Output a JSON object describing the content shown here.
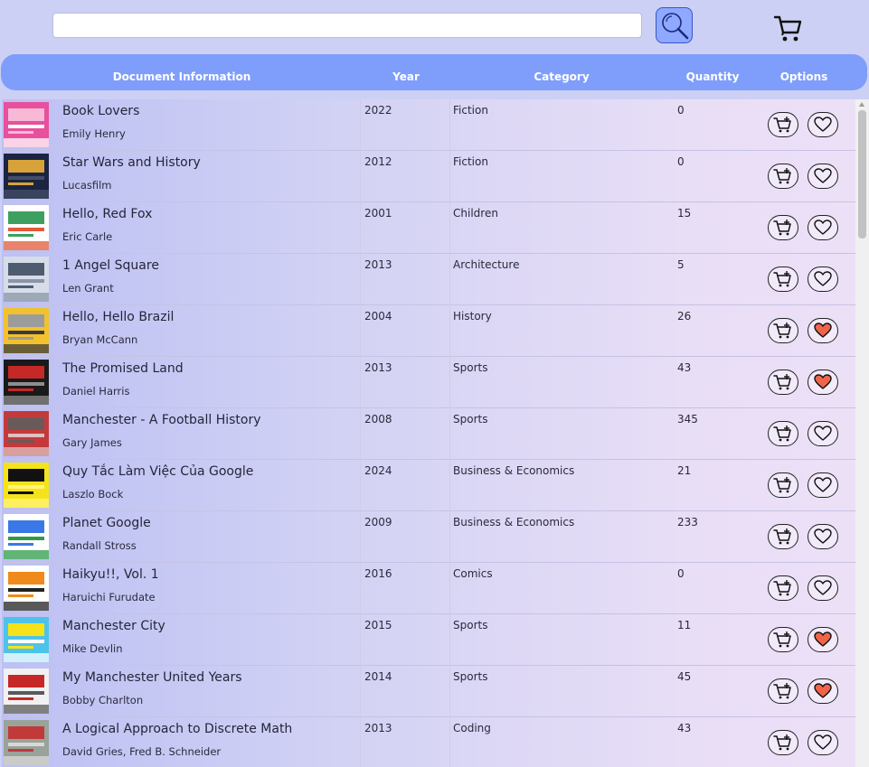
{
  "search": {
    "placeholder": "",
    "value": ""
  },
  "icons": {
    "search": "search-icon",
    "cart": "cart-icon",
    "add_to_cart": "add-to-cart-icon",
    "favorite": "heart-icon"
  },
  "colors": {
    "page_bg": "#cdd0f5",
    "header_bg": "#7f9dfb",
    "search_button_bg": "#8ea9ff",
    "favorite_active": "#f0654a"
  },
  "table": {
    "columns": [
      "Document Information",
      "Year",
      "Category",
      "Quantity",
      "Options"
    ],
    "rows": [
      {
        "title": "Book Lovers",
        "author": "Emily Henry",
        "year": "2022",
        "category": "Fiction",
        "quantity": "0",
        "favorite": false,
        "cover_colors": [
          "#e84f9c",
          "#f7b9d6",
          "#ffffff"
        ]
      },
      {
        "title": "Star Wars and History",
        "author": "Lucasfilm",
        "year": "2012",
        "category": "Fiction",
        "quantity": "0",
        "favorite": false,
        "cover_colors": [
          "#1b2440",
          "#d8a23a",
          "#444c68"
        ]
      },
      {
        "title": "Hello, Red Fox",
        "author": "Eric Carle",
        "year": "2001",
        "category": "Children",
        "quantity": "15",
        "favorite": false,
        "cover_colors": [
          "#ffffff",
          "#3da060",
          "#e35a3a"
        ]
      },
      {
        "title": "1 Angel Square",
        "author": "Len Grant",
        "year": "2013",
        "category": "Architecture",
        "quantity": "5",
        "favorite": false,
        "cover_colors": [
          "#d6dde8",
          "#4f5b6f",
          "#8a95a8"
        ]
      },
      {
        "title": "Hello, Hello Brazil",
        "author": "Bryan McCann",
        "year": "2004",
        "category": "History",
        "quantity": "26",
        "favorite": true,
        "cover_colors": [
          "#f2c12e",
          "#9c9c9c",
          "#3c3c3c"
        ]
      },
      {
        "title": "The Promised Land",
        "author": "Daniel Harris",
        "year": "2013",
        "category": "Sports",
        "quantity": "43",
        "favorite": true,
        "cover_colors": [
          "#1a1a1a",
          "#c62828",
          "#8e8e8e"
        ]
      },
      {
        "title": "Manchester - A Football History",
        "author": "Gary James",
        "year": "2008",
        "category": "Sports",
        "quantity": "345",
        "favorite": false,
        "cover_colors": [
          "#c43a3a",
          "#6a5a5a",
          "#e0c0c0"
        ]
      },
      {
        "title": "Quy Tắc Làm Việc Của Google",
        "author": "Laszlo Bock",
        "year": "2024",
        "category": "Business & Economics",
        "quantity": "21",
        "favorite": false,
        "cover_colors": [
          "#f4e31b",
          "#111111",
          "#fff47a"
        ]
      },
      {
        "title": "Planet Google",
        "author": "Randall Stross",
        "year": "2009",
        "category": "Business & Economics",
        "quantity": "233",
        "favorite": false,
        "cover_colors": [
          "#ffffff",
          "#3b78e7",
          "#2e9b4a"
        ]
      },
      {
        "title": "Haikyu!!, Vol. 1",
        "author": "Haruichi Furudate",
        "year": "2016",
        "category": "Comics",
        "quantity": "0",
        "favorite": false,
        "cover_colors": [
          "#ffffff",
          "#f08a1c",
          "#222222"
        ]
      },
      {
        "title": "Manchester City",
        "author": "Mike Devlin",
        "year": "2015",
        "category": "Sports",
        "quantity": "11",
        "favorite": true,
        "cover_colors": [
          "#4dc3ea",
          "#f6e21b",
          "#ffffff"
        ]
      },
      {
        "title": "My Manchester United Years",
        "author": "Bobby Charlton",
        "year": "2014",
        "category": "Sports",
        "quantity": "45",
        "favorite": true,
        "cover_colors": [
          "#f1f1f1",
          "#c62828",
          "#5a5a5a"
        ]
      },
      {
        "title": "A Logical Approach to Discrete Math",
        "author": "David Gries, Fred B. Schneider",
        "year": "2013",
        "category": "Coding",
        "quantity": "43",
        "favorite": false,
        "cover_colors": [
          "#9aa39a",
          "#c03a3a",
          "#d8d8d8"
        ]
      }
    ]
  }
}
